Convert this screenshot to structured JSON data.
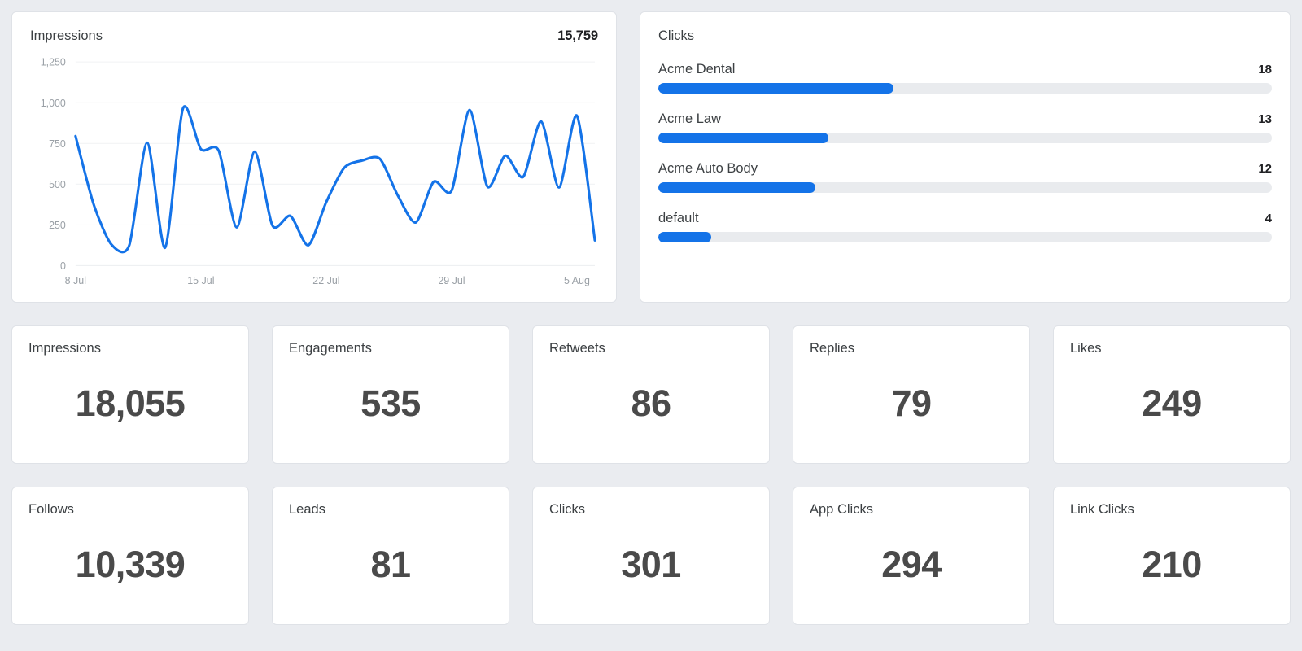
{
  "impressions_panel": {
    "title": "Impressions",
    "total": "15,759"
  },
  "clicks_panel": {
    "title": "Clicks",
    "rows": [
      {
        "label": "Acme Dental",
        "value": "18",
        "percent": 38.3
      },
      {
        "label": "Acme Law",
        "value": "13",
        "percent": 27.7
      },
      {
        "label": "Acme Auto Body",
        "value": "12",
        "percent": 25.6
      },
      {
        "label": "default",
        "value": "4",
        "percent": 8.6
      }
    ]
  },
  "stats": [
    {
      "label": "Impressions",
      "value": "18,055"
    },
    {
      "label": "Engagements",
      "value": "535"
    },
    {
      "label": "Retweets",
      "value": "86"
    },
    {
      "label": "Replies",
      "value": "79"
    },
    {
      "label": "Likes",
      "value": "249"
    },
    {
      "label": "Follows",
      "value": "10,339"
    },
    {
      "label": "Leads",
      "value": "81"
    },
    {
      "label": "Clicks",
      "value": "301"
    },
    {
      "label": "App Clicks",
      "value": "294"
    },
    {
      "label": "Link Clicks",
      "value": "210"
    }
  ],
  "colors": {
    "accent": "#1473e8",
    "track": "#e9ebee",
    "page_bg": "#eaecf0",
    "card_bg": "#ffffff",
    "card_border": "#dfe2e7",
    "label_text": "#3c4043",
    "value_text": "#4a4a4a",
    "axis_text": "#9aa0a6",
    "grid": "#f1f2f4"
  },
  "chart_data": {
    "type": "line",
    "title": "Impressions",
    "xlabel": "",
    "ylabel": "",
    "grid": true,
    "legend": "none",
    "ylim": [
      0,
      1250
    ],
    "y_ticks": [
      0,
      250,
      500,
      750,
      1000,
      1250
    ],
    "y_tick_labels": [
      "0",
      "250",
      "500",
      "750",
      "1,000",
      "1,250"
    ],
    "x_tick_labels": [
      "8 Jul",
      "15 Jul",
      "22 Jul",
      "29 Jul",
      "5 Aug"
    ],
    "x_tick_indices": [
      0,
      7,
      14,
      21,
      28
    ],
    "x": [
      "8 Jul",
      "9 Jul",
      "10 Jul",
      "11 Jul",
      "12 Jul",
      "13 Jul",
      "14 Jul",
      "15 Jul",
      "16 Jul",
      "17 Jul",
      "18 Jul",
      "19 Jul",
      "20 Jul",
      "21 Jul",
      "22 Jul",
      "23 Jul",
      "24 Jul",
      "25 Jul",
      "26 Jul",
      "27 Jul",
      "28 Jul",
      "29 Jul",
      "30 Jul",
      "31 Jul",
      "1 Aug",
      "2 Aug",
      "3 Aug",
      "4 Aug",
      "5 Aug"
    ],
    "series": [
      {
        "name": "Impressions",
        "color": "#1473e8",
        "values": [
          795,
          380,
          130,
          125,
          755,
          110,
          965,
          715,
          705,
          235,
          700,
          245,
          305,
          125,
          390,
          600,
          645,
          655,
          430,
          265,
          515,
          460,
          955,
          485,
          675,
          545,
          885,
          480,
          920,
          155
        ]
      }
    ]
  }
}
